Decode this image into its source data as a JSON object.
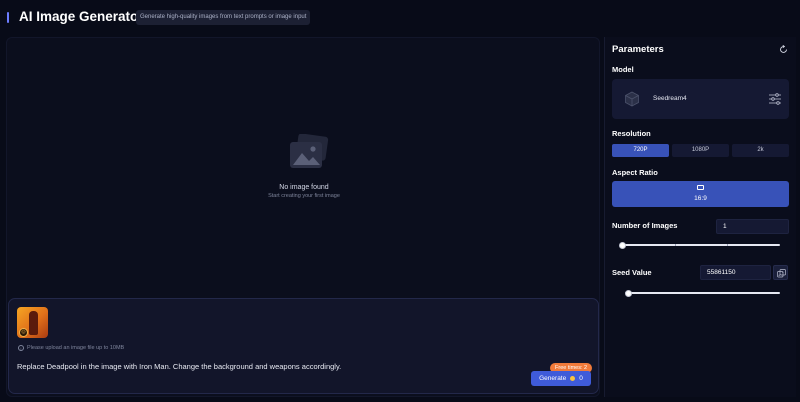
{
  "header": {
    "title": "AI Image Generator",
    "subtitle": "Generate high-quality images from text prompts or image input"
  },
  "canvas": {
    "empty_title": "No image found",
    "empty_subtitle": "Start creating your first image"
  },
  "prompt": {
    "upload_hint": "Please upload an image file up to 10MB",
    "text": "Replace Deadpool in the image with Iron Man. Change the background and weapons accordingly.",
    "free_times_label": "Free times: 2",
    "generate_label": "Generate",
    "credit_cost": "0"
  },
  "parameters": {
    "title": "Parameters",
    "model": {
      "label": "Model",
      "name": "Seedream4"
    },
    "resolution": {
      "label": "Resolution",
      "options": [
        "720P",
        "1080P",
        "2k"
      ],
      "selected": "720P"
    },
    "aspect_ratio": {
      "label": "Aspect Ratio",
      "value": "16:9"
    },
    "num_images": {
      "label": "Number of Images",
      "value": "1",
      "slider_fraction": 0.0
    },
    "seed": {
      "label": "Seed Value",
      "value": "55861150",
      "slider_fraction": 0.02
    }
  },
  "colors": {
    "background": "#080b18",
    "accent": "#3852b8",
    "generate": "#3f5bd9",
    "free_badge": "#f07a3a"
  }
}
